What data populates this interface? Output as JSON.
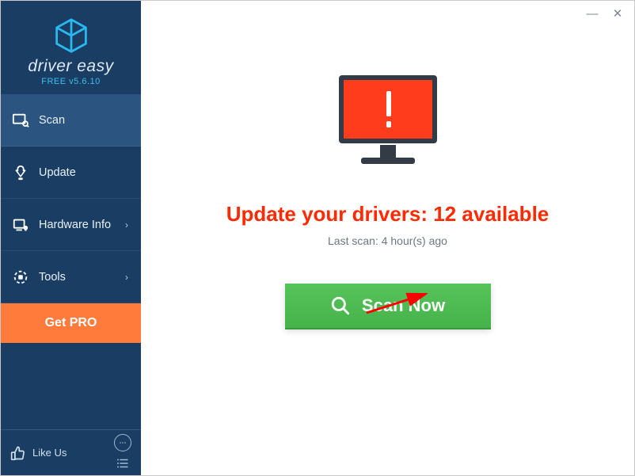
{
  "brand": {
    "wordmark": "driver easy",
    "version_prefix": "FREE v",
    "version": "5.6.10"
  },
  "sidebar": {
    "items": [
      {
        "label": "Scan",
        "active": true,
        "arrow": false
      },
      {
        "label": "Update",
        "active": false,
        "arrow": false
      },
      {
        "label": "Hardware Info",
        "active": false,
        "arrow": true
      },
      {
        "label": "Tools",
        "active": false,
        "arrow": true
      }
    ],
    "get_pro_label": "Get PRO",
    "like_label": "Like Us"
  },
  "titlebar": {
    "minimize": "—",
    "close": "✕"
  },
  "main": {
    "headline_prefix": "Update your drivers: ",
    "available_count": 12,
    "headline_suffix": " available",
    "last_scan_prefix": "Last scan: ",
    "last_scan_value": "4 hour(s) ago",
    "scan_button_label": "Scan Now"
  },
  "colors": {
    "sidebar_bg": "#193d63",
    "sidebar_active": "#2b5481",
    "accent_orange": "#ff7b3c",
    "headline_red": "#ff2a00",
    "cta_green": "#4dbb51",
    "brand_cyan": "#2ab8ef",
    "monitor_red": "#ff3d1c"
  }
}
